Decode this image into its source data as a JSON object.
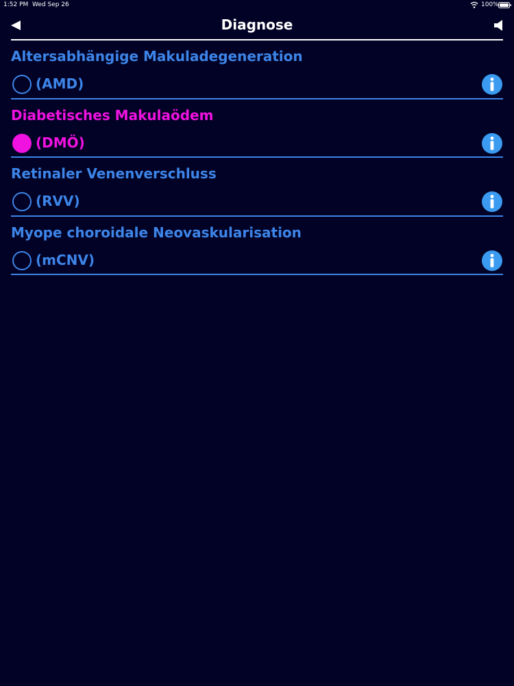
{
  "status_bar": {
    "time": "1:52 PM",
    "date": "Wed Sep 26",
    "battery": "100%",
    "icons": [
      "wifi-icon",
      "battery-icon"
    ]
  },
  "nav": {
    "title": "Diagnose",
    "left_icon": "back-arrow-icon",
    "right_icon": "speaker-icon"
  },
  "colors": {
    "background": "#020226",
    "accent": "#3d85e8",
    "selected": "#f012e0",
    "text": "#ffffff"
  },
  "diagnoses": [
    {
      "name": "Altersabhängige Makuladegeneration",
      "abbr": "(AMD)",
      "selected": false
    },
    {
      "name": "Diabetisches Makulaödem",
      "abbr": "(DMÖ)",
      "selected": true
    },
    {
      "name": "Retinaler Venenverschluss",
      "abbr": "(RVV)",
      "selected": false
    },
    {
      "name": "Myope choroidale Neovaskularisation",
      "abbr": "(mCNV)",
      "selected": false
    }
  ]
}
